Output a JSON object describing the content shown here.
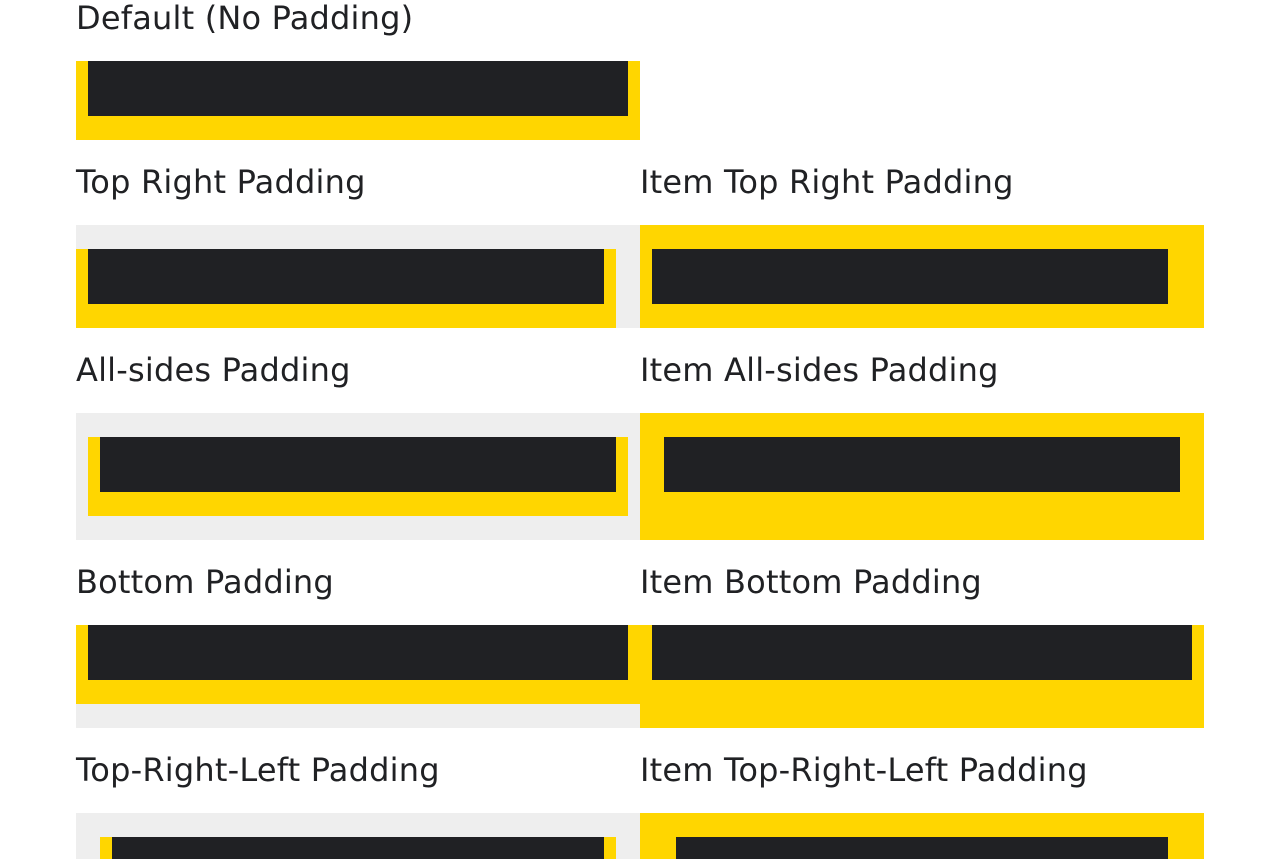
{
  "sections": {
    "default": {
      "label": "Default (No Padding)"
    },
    "top_right": {
      "label": "Top Right Padding",
      "item_label": "Item Top Right Padding"
    },
    "all_sides": {
      "label": "All-sides Padding",
      "item_label": "Item All-sides Padding"
    },
    "bottom": {
      "label": "Bottom Padding",
      "item_label": "Item Bottom Padding"
    },
    "top_right_left": {
      "label": "Top-Right-Left Padding",
      "item_label": "Item Top-Right-Left Padding"
    }
  },
  "colors": {
    "container": "#eeeeee",
    "item": "#ffd600",
    "content": "#202124",
    "text": "#202124"
  }
}
